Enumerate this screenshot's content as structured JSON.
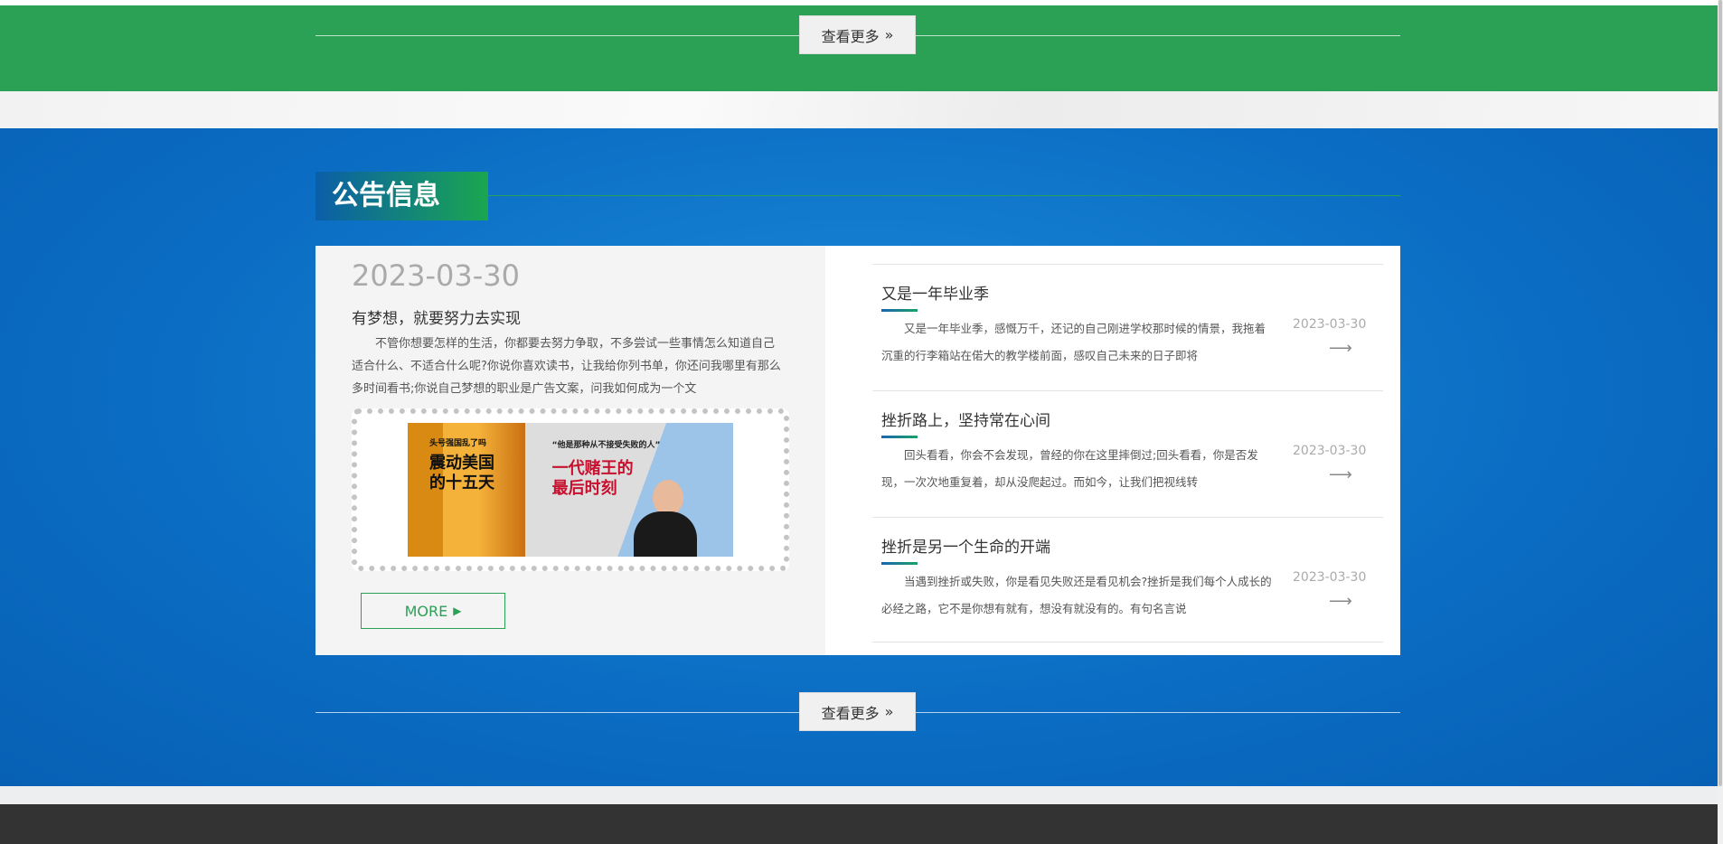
{
  "top_section": {
    "more_label": "查看更多",
    "more_icon": "double-chevron-right-icon"
  },
  "notice": {
    "title": "公告信息",
    "featured": {
      "date": "2023-03-30",
      "title": "有梦想，就要努力去实现",
      "body": "不管你想要怎样的生活，你都要去努力争取，不多尝试一些事情怎么知道自己适合什么、不适合什么呢?你说你喜欢读书，让我给你列书单，你还问我哪里有那么多时间看书;你说自己梦想的职业是广告文案，问我如何成为一个文",
      "image_text": {
        "left_small": "头号强国乱了吗",
        "left_big_1": "震动美国",
        "left_big_2": "的十五天",
        "right_quote": "“他是那种从不接受失败的人”",
        "right_big_1": "一代赌王的",
        "right_big_2": "最后时刻"
      },
      "more_label": "MORE",
      "more_icon": "play-triangle-icon"
    },
    "items": [
      {
        "title": "又是一年毕业季",
        "body": "又是一年毕业季，感慨万千，还记的自己刚进学校那时候的情景，我拖着沉重的行李箱站在偌大的教学楼前面，感叹自己未来的日子即将",
        "date": "2023-03-30"
      },
      {
        "title": "挫折路上，坚持常在心间",
        "body": "回头看看，你会不会发现，曾经的你在这里摔倒过;回头看看，你是否发现，一次次地重复着，却从没爬起过。而如今，让我们把视线转",
        "date": "2023-03-30"
      },
      {
        "title": "挫折是另一个生命的开端",
        "body": "当遇到挫折或失败，你是看见失败还是看见机会?挫折是我们每个人成长的必经之路，它不是你想有就有，想没有就没有的。有句名言说",
        "date": "2023-03-30"
      }
    ],
    "more_label": "查看更多"
  },
  "colors": {
    "green": "#2ba156",
    "blue": "#0a6cc2",
    "footer": "#333333"
  }
}
